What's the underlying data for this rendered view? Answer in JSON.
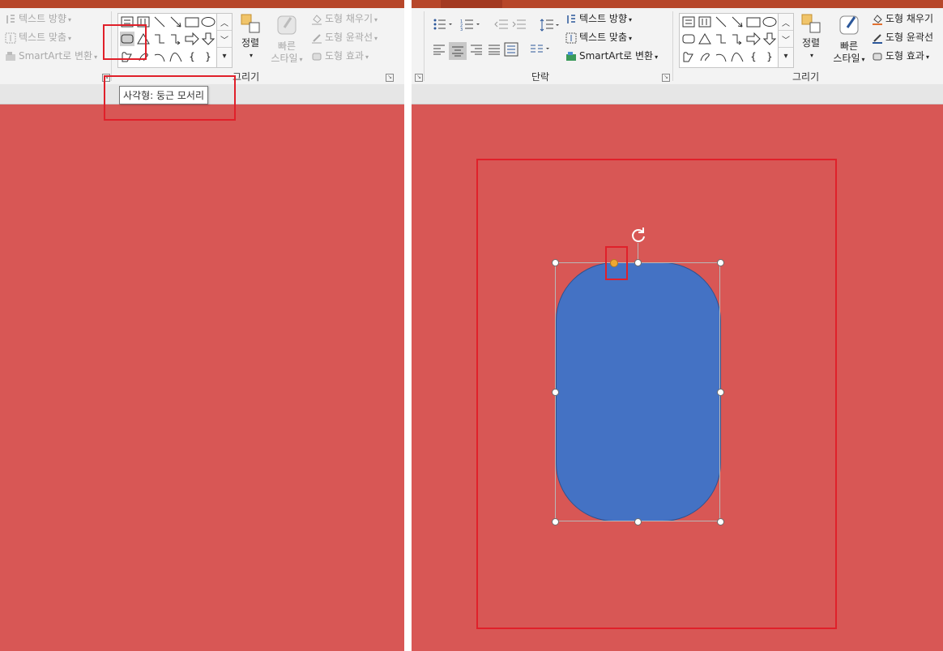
{
  "left_panel": {
    "text_direction": "텍스트 방향",
    "text_align": "텍스트 맞춤",
    "smartart": "SmartArt로 변환",
    "arrange": "정렬",
    "quick_styles_1": "빠른",
    "quick_styles_2": "스타일",
    "shape_fill": "도형 채우기",
    "shape_outline": "도형 윤곽선",
    "shape_effects": "도형 효과",
    "drawing_group": "그리기",
    "tooltip": "사각형: 둥근 모서리"
  },
  "right_panel": {
    "text_direction": "텍스트 방향",
    "text_align": "텍스트 맞춤",
    "smartart": "SmartArt로 변환",
    "paragraph_group": "단락",
    "arrange": "정렬",
    "quick_styles_1": "빠른",
    "quick_styles_2": "스타일",
    "shape_fill": "도형 채우기",
    "shape_outline": "도형 윤곽선",
    "shape_effects": "도형 효과",
    "drawing_group": "그리기"
  },
  "gallery_glyphs": {
    "brace_open": "{",
    "brace_close": "}"
  },
  "colors": {
    "slide": "#d85755",
    "shape_fill": "#4472c4",
    "accent": "#b7472a",
    "annotation": "#e0202a",
    "adjust_handle": "#f0a830"
  },
  "icons": [
    "text-direction-icon",
    "text-align-icon",
    "smartart-icon",
    "arrange-icon",
    "quick-styles-icon",
    "shape-fill-icon",
    "shape-outline-icon",
    "shape-effects-icon",
    "rotate-icon",
    "bullets-icon",
    "numbering-icon",
    "align-left-icon",
    "align-center-icon",
    "align-right-icon",
    "justify-icon"
  ]
}
